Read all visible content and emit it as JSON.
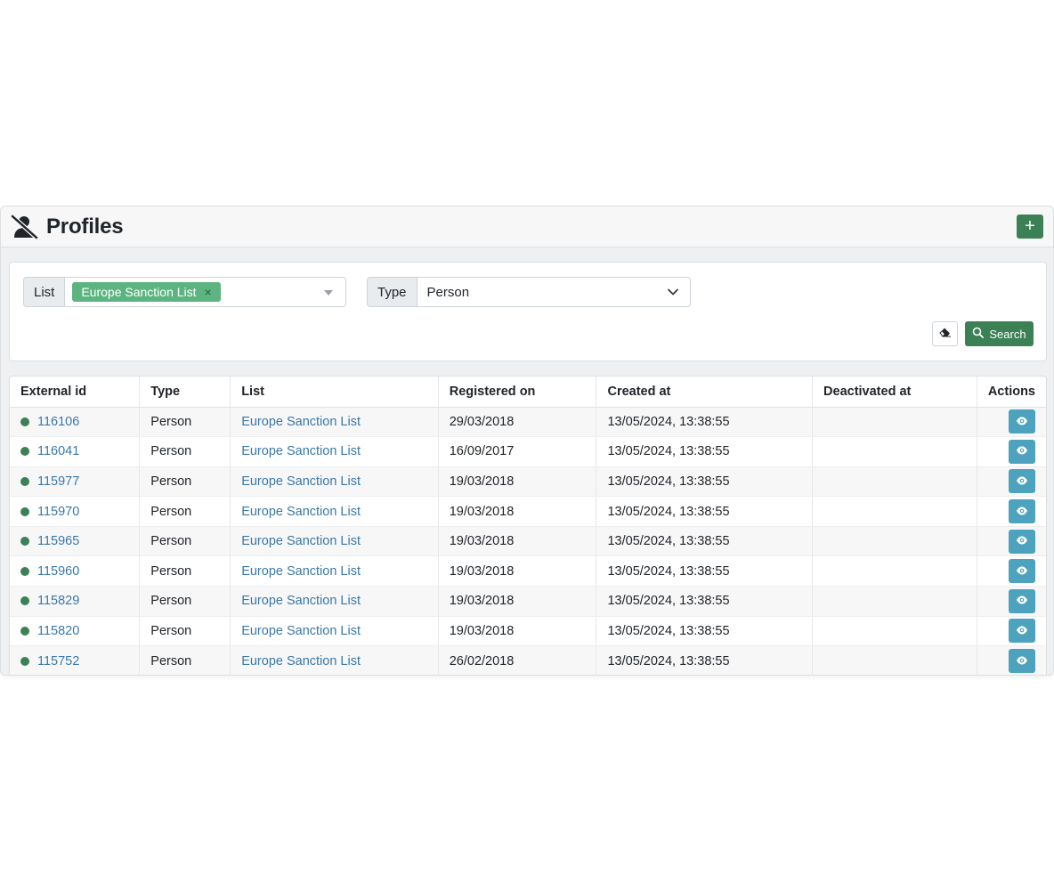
{
  "header": {
    "title": "Profiles",
    "add_label": "+"
  },
  "filters": {
    "list_label": "List",
    "list_tag": "Europe Sanction List",
    "list_tag_remove": "×",
    "type_label": "Type",
    "type_value": "Person",
    "search_label": "Search"
  },
  "table": {
    "columns": [
      "External id",
      "Type",
      "List",
      "Registered on",
      "Created at",
      "Deactivated at",
      "Actions"
    ],
    "rows": [
      {
        "id": "116106",
        "type": "Person",
        "list": "Europe Sanction List",
        "registered": "29/03/2018",
        "created": "13/05/2024, 13:38:55",
        "deactivated": ""
      },
      {
        "id": "116041",
        "type": "Person",
        "list": "Europe Sanction List",
        "registered": "16/09/2017",
        "created": "13/05/2024, 13:38:55",
        "deactivated": ""
      },
      {
        "id": "115977",
        "type": "Person",
        "list": "Europe Sanction List",
        "registered": "19/03/2018",
        "created": "13/05/2024, 13:38:55",
        "deactivated": ""
      },
      {
        "id": "115970",
        "type": "Person",
        "list": "Europe Sanction List",
        "registered": "19/03/2018",
        "created": "13/05/2024, 13:38:55",
        "deactivated": ""
      },
      {
        "id": "115965",
        "type": "Person",
        "list": "Europe Sanction List",
        "registered": "19/03/2018",
        "created": "13/05/2024, 13:38:55",
        "deactivated": ""
      },
      {
        "id": "115960",
        "type": "Person",
        "list": "Europe Sanction List",
        "registered": "19/03/2018",
        "created": "13/05/2024, 13:38:55",
        "deactivated": ""
      },
      {
        "id": "115829",
        "type": "Person",
        "list": "Europe Sanction List",
        "registered": "19/03/2018",
        "created": "13/05/2024, 13:38:55",
        "deactivated": ""
      },
      {
        "id": "115820",
        "type": "Person",
        "list": "Europe Sanction List",
        "registered": "19/03/2018",
        "created": "13/05/2024, 13:38:55",
        "deactivated": ""
      },
      {
        "id": "115752",
        "type": "Person",
        "list": "Europe Sanction List",
        "registered": "26/02/2018",
        "created": "13/05/2024, 13:38:55",
        "deactivated": ""
      }
    ]
  },
  "colors": {
    "primary_green": "#3b8155",
    "tag_green": "#5cb581",
    "link_blue": "#3a78a8",
    "view_button": "#4da3bd",
    "status_active": "#3b8155"
  },
  "icons": {
    "title": "user-slash-icon",
    "add": "plus-icon",
    "clear": "eraser-icon",
    "search": "search-icon",
    "view": "eye-icon",
    "status": "status-dot-icon"
  }
}
